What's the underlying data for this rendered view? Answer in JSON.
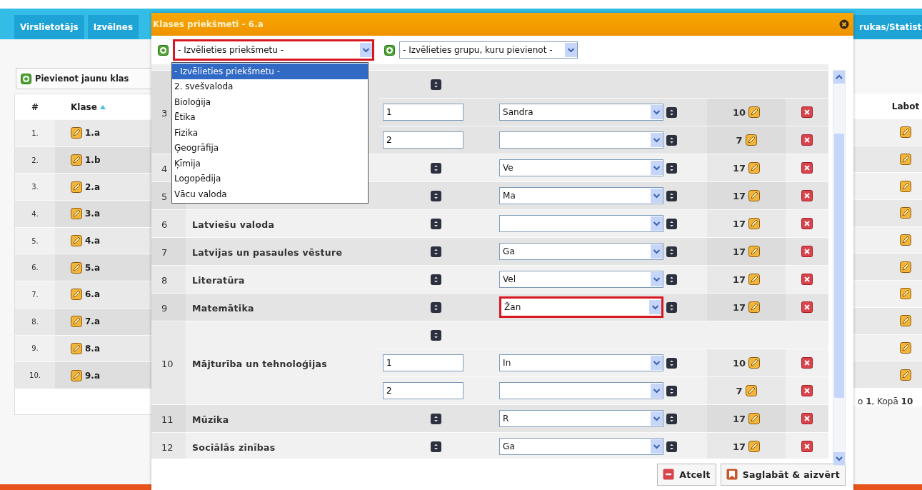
{
  "nav": {
    "tabs": [
      "Virslietotājs",
      "Izvēlnes",
      "rukas/Statist"
    ]
  },
  "add_button": "Pievienot jaunu klas",
  "classes": {
    "columns": [
      "#",
      "Klase",
      "Labot"
    ],
    "rows": [
      {
        "number": "1.",
        "class": "1.a"
      },
      {
        "number": "2.",
        "class": "1.b"
      },
      {
        "number": "3.",
        "class": "2.a"
      },
      {
        "number": "4.",
        "class": "3.a"
      },
      {
        "number": "5.",
        "class": "4.a"
      },
      {
        "number": "6.",
        "class": "5.a"
      },
      {
        "number": "7.",
        "class": "6.a"
      },
      {
        "number": "8.",
        "class": "7.a"
      },
      {
        "number": "9.",
        "class": "8.a"
      },
      {
        "number": "10.",
        "class": "9.a"
      }
    ],
    "pagination": "o **1**, Kopā **10**"
  },
  "modal": {
    "title": "Klases priekšmeti - 6.a",
    "subject_select": {
      "value": "- Izvēlieties priekšmetu -",
      "highlighted": true,
      "expanded": true,
      "options": [
        {
          "label": "- Izvēlieties priekšmetu -",
          "selected": true
        },
        {
          "label": "2. svešvaloda",
          "selected": false
        },
        {
          "label": "Bioloģija",
          "selected": false
        },
        {
          "label": "Ētika",
          "selected": false
        },
        {
          "label": "Fizika",
          "selected": false
        },
        {
          "label": "Ģeogrāfija",
          "selected": false
        },
        {
          "label": "Ķīmija",
          "selected": false
        },
        {
          "label": "Logopēdija",
          "selected": false
        },
        {
          "label": "Vācu valoda",
          "selected": false
        }
      ]
    },
    "group_select": {
      "value": "- Izvēlieties grupu, kuru pievienot -"
    },
    "rows": [
      {
        "number": "3",
        "groups": [
          {
            "group": "1",
            "teacher": "Sandra",
            "hours": "10"
          },
          {
            "group": "2",
            "hours": "7"
          }
        ]
      },
      {
        "number": "4",
        "teacher": "Ve",
        "hours": "17",
        "highlighted": false
      },
      {
        "number": "5",
        "teacher": "Ma",
        "hours": "17",
        "highlighted": false
      },
      {
        "number": "6",
        "name": "Latviešu valoda",
        "hours": "17",
        "highlighted": false
      },
      {
        "number": "7",
        "name": "Latvijas un pasaules vēsture",
        "teacher": "Ga",
        "hours": "17",
        "highlighted": false
      },
      {
        "number": "8",
        "name": "Literatūra",
        "teacher": "Vel",
        "hours": "17",
        "highlighted": false
      },
      {
        "number": "9",
        "name": "Matemātika",
        "teacher": "Žan",
        "hours": "17",
        "highlighted": true
      },
      {
        "number": "10",
        "name": "Mājturība un tehnoloģijas",
        "groups": [
          {
            "group": "1",
            "teacher": "In",
            "hours": "10"
          },
          {
            "group": "2",
            "hours": "7"
          }
        ]
      },
      {
        "number": "11",
        "name": "Mūzika",
        "teacher": "R",
        "hours": "17",
        "highlighted": false
      },
      {
        "number": "12",
        "name": "Sociālās zinības",
        "teacher": "Ga",
        "hours": "17",
        "highlighted": false
      }
    ],
    "buttons": [
      {
        "kind": "cancel",
        "label": "Atcelt"
      },
      {
        "kind": "save",
        "label": "Saglabāt & aizvērt"
      }
    ]
  }
}
